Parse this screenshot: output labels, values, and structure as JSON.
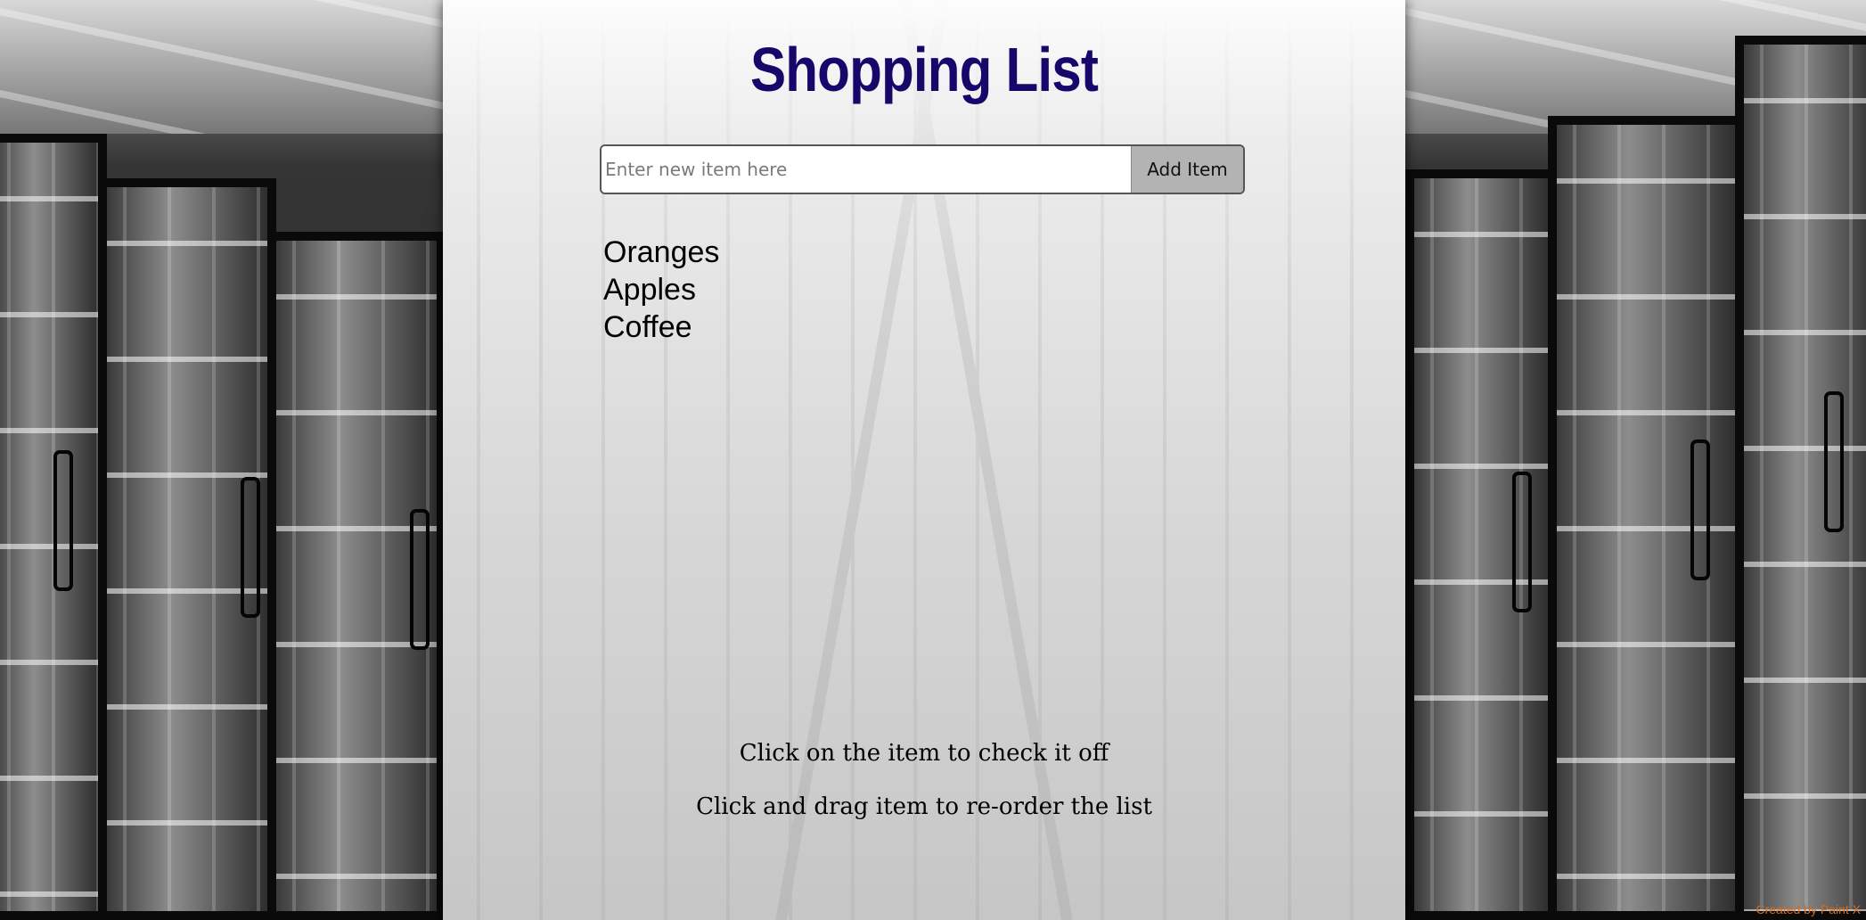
{
  "header": {
    "title": "Shopping List"
  },
  "form": {
    "placeholder": "Enter new item here",
    "value": "",
    "button_label": "Add Item"
  },
  "list": {
    "items": [
      {
        "label": "Oranges"
      },
      {
        "label": "Apples"
      },
      {
        "label": "Coffee"
      }
    ]
  },
  "instructions": {
    "line1": "Click on the item to check it off",
    "line2": "Click and drag item to re-order the list"
  },
  "footer": {
    "credit": "Created by Paint X"
  },
  "colors": {
    "title": "#16086a",
    "button_bg": "#b3b3b3",
    "credit": "#d86b1e"
  }
}
